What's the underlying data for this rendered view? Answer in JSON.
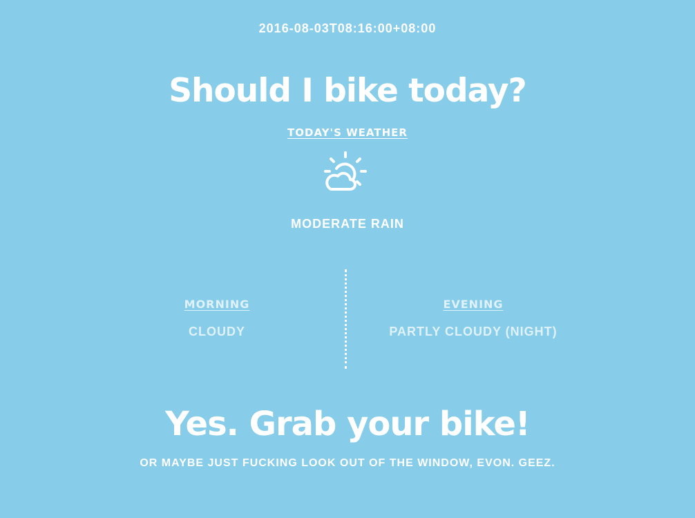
{
  "header": {
    "timestamp": "2016-08-03T08:16:00+08:00",
    "title": "Should I bike today?"
  },
  "today": {
    "label": "TODAY'S WEATHER",
    "icon": "sun-cloud-icon",
    "condition": "MODERATE RAIN"
  },
  "morning": {
    "label": "MORNING",
    "condition": "CLOUDY"
  },
  "evening": {
    "label": "EVENING",
    "condition": "PARTLY CLOUDY (NIGHT)"
  },
  "verdict": {
    "answer": "Yes. Grab your bike!",
    "note": "OR MAYBE JUST FUCKING LOOK OUT OF THE WINDOW, EVON. GEEZ."
  },
  "colors": {
    "background": "#87cdea",
    "text": "#ffffff",
    "muted_text": "#dff2fa"
  }
}
